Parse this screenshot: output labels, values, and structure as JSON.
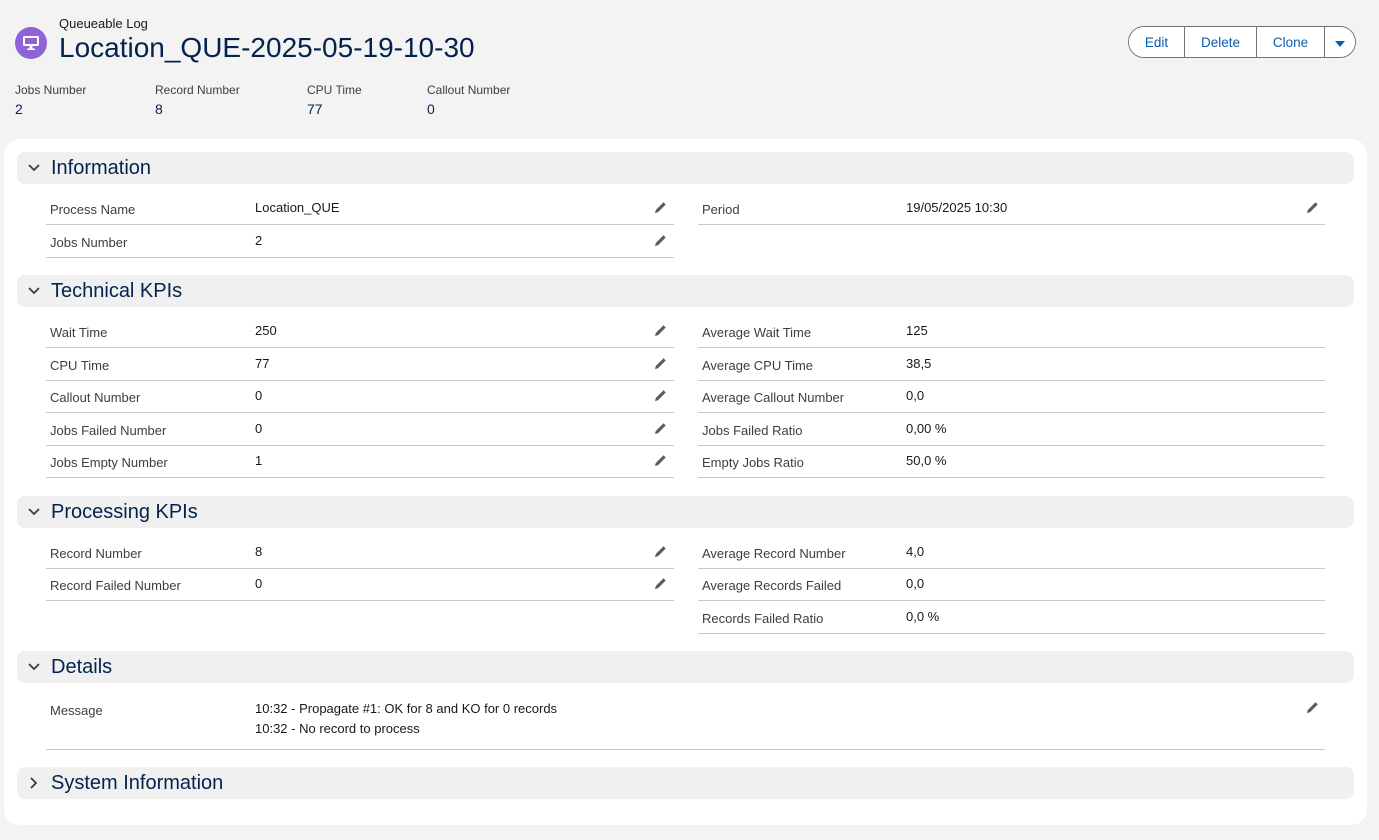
{
  "header": {
    "object_label": "Queueable Log",
    "title": "Location_QUE-2025-05-19-10-30",
    "buttons": {
      "edit": "Edit",
      "delete": "Delete",
      "clone": "Clone"
    },
    "highlights": [
      {
        "label": "Jobs Number",
        "value": "2"
      },
      {
        "label": "Record Number",
        "value": "8"
      },
      {
        "label": "CPU Time",
        "value": "77"
      },
      {
        "label": "Callout Number",
        "value": "0"
      }
    ]
  },
  "sections": {
    "information": {
      "title": "Information",
      "left": [
        {
          "label": "Process Name",
          "value": "Location_QUE"
        },
        {
          "label": "Jobs Number",
          "value": "2"
        }
      ],
      "right": [
        {
          "label": "Period",
          "value": "19/05/2025 10:30"
        }
      ]
    },
    "technical": {
      "title": "Technical KPIs",
      "left": [
        {
          "label": "Wait Time",
          "value": "250"
        },
        {
          "label": "CPU Time",
          "value": "77"
        },
        {
          "label": "Callout Number",
          "value": "0"
        },
        {
          "label": "Jobs Failed Number",
          "value": "0"
        },
        {
          "label": "Jobs Empty Number",
          "value": "1"
        }
      ],
      "right": [
        {
          "label": "Average Wait Time",
          "value": "125"
        },
        {
          "label": "Average CPU Time",
          "value": "38,5"
        },
        {
          "label": "Average Callout Number",
          "value": "0,0"
        },
        {
          "label": "Jobs Failed Ratio",
          "value": "0,00 %"
        },
        {
          "label": "Empty Jobs Ratio",
          "value": "50,0 %"
        }
      ]
    },
    "processing": {
      "title": "Processing KPIs",
      "left": [
        {
          "label": "Record Number",
          "value": "8"
        },
        {
          "label": "Record Failed Number",
          "value": "0"
        }
      ],
      "right": [
        {
          "label": "Average Record Number",
          "value": "4,0"
        },
        {
          "label": "Average Records Failed",
          "value": "0,0"
        },
        {
          "label": "Records Failed Ratio",
          "value": "0,0 %"
        }
      ]
    },
    "details": {
      "title": "Details",
      "message_label": "Message",
      "message_lines": [
        "10:32 - Propagate #1: OK for 8 and KO for 0 records",
        "10:32 - No record to process"
      ]
    },
    "system": {
      "title": "System Information"
    }
  },
  "icons": {
    "object": "monitor-icon",
    "edit_field": "pencil-icon",
    "expanded": "chevron-down-icon",
    "collapsed": "chevron-right-icon",
    "more": "caret-down-icon"
  },
  "colors": {
    "object_icon_bg": "#8e63d8",
    "title": "#03234d",
    "button_text": "#0b5cab",
    "section_bg": "#f0f0f0"
  }
}
